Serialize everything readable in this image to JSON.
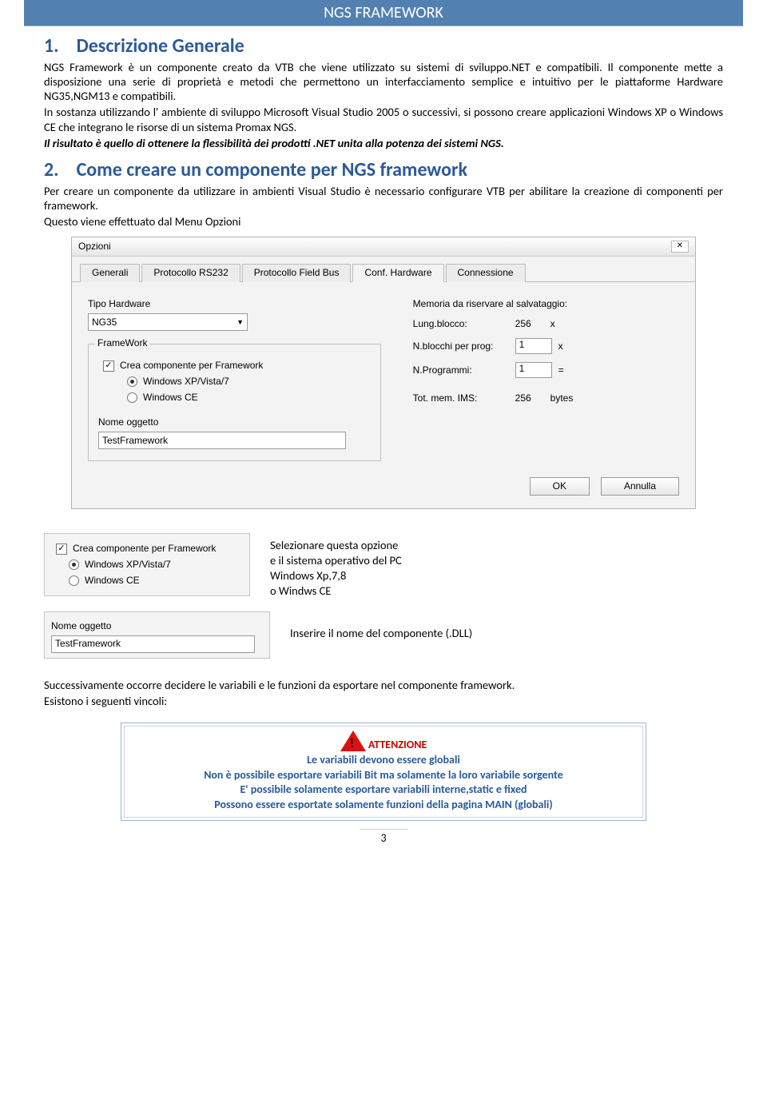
{
  "header": "NGS FRAMEWORK",
  "sec1": {
    "num": "1.",
    "title": "Descrizione Generale",
    "p1": "NGS Framework è un componente creato da VTB che viene utilizzato su sistemi di sviluppo.NET e compatibili. Il componente mette a disposizione una serie di proprietà e metodi che permettono un interfacciamento semplice e intuitivo per le piattaforme Hardware NG35,NGM13 e compatibili.",
    "p2": "In sostanza utilizzando l' ambiente di sviluppo Microsoft Visual Studio 2005 o successivi, si possono creare applicazioni Windows XP o Windows CE che integrano le risorse di un sistema Promax NGS.",
    "p3": "Il risultato è quello di ottenere la flessibilità dei prodotti .NET unita alla potenza dei sistemi NGS."
  },
  "sec2": {
    "num": "2.",
    "title": "Come creare un componente per NGS framework",
    "p1": "Per creare un componente da utilizzare in ambienti Visual Studio è necessario configurare VTB per abilitare la creazione di componenti per framework.",
    "p2": "Questo viene effettuato dal Menu Opzioni"
  },
  "dialog": {
    "title": "Opzioni",
    "tabs": [
      "Generali",
      "Protocollo RS232",
      "Protocollo Field Bus",
      "Conf. Hardware",
      "Connessione"
    ],
    "hwlabel": "Tipo Hardware",
    "hwvalue": "NG35",
    "fwlegend": "FrameWork",
    "chk": "Crea componente per Framework",
    "radio1": "Windows XP/Vista/7",
    "radio2": "Windows CE",
    "objlabel": "Nome oggetto",
    "objvalue": "TestFramework",
    "memheader": "Memoria da riservare al salvataggio:",
    "m1l": "Lung.blocco:",
    "m1v": "256",
    "m1s": "x",
    "m2l": "N.blocchi per prog:",
    "m2v": "1",
    "m2s": "x",
    "m3l": "N.Programmi:",
    "m3v": "1",
    "m3s": "=",
    "m4l": "Tot. mem. IMS:",
    "m4v": "256",
    "m4s": "bytes",
    "ok": "OK",
    "cancel": "Annulla"
  },
  "snip1": {
    "chk": "Crea componente per Framework",
    "r1": "Windows XP/Vista/7",
    "r2": "Windows CE",
    "t1": "Selezionare questa opzione",
    "t2": "e il sistema operativo del PC",
    "t3": "Windows Xp,7,8",
    "t4": "o Windws CE"
  },
  "snip2": {
    "lbl": "Nome oggetto",
    "val": "TestFramework",
    "txt": "Inserire il nome del componente (.DLL)"
  },
  "after1": "Successivamente occorre decidere le variabili e le funzioni da esportare nel componente framework.",
  "after2": "Esistono i seguenti vincoli:",
  "warn": {
    "title": "ATTENZIONE",
    "l1": "Le variabili devono essere globali",
    "l2": "Non è possibile esportare variabili Bit ma solamente la loro variabile sorgente",
    "l3": "E' possibile solamente esportare variabili interne,static e fixed",
    "l4": "Possono essere esportate solamente funzioni della pagina MAIN (globali)"
  },
  "page": "3"
}
